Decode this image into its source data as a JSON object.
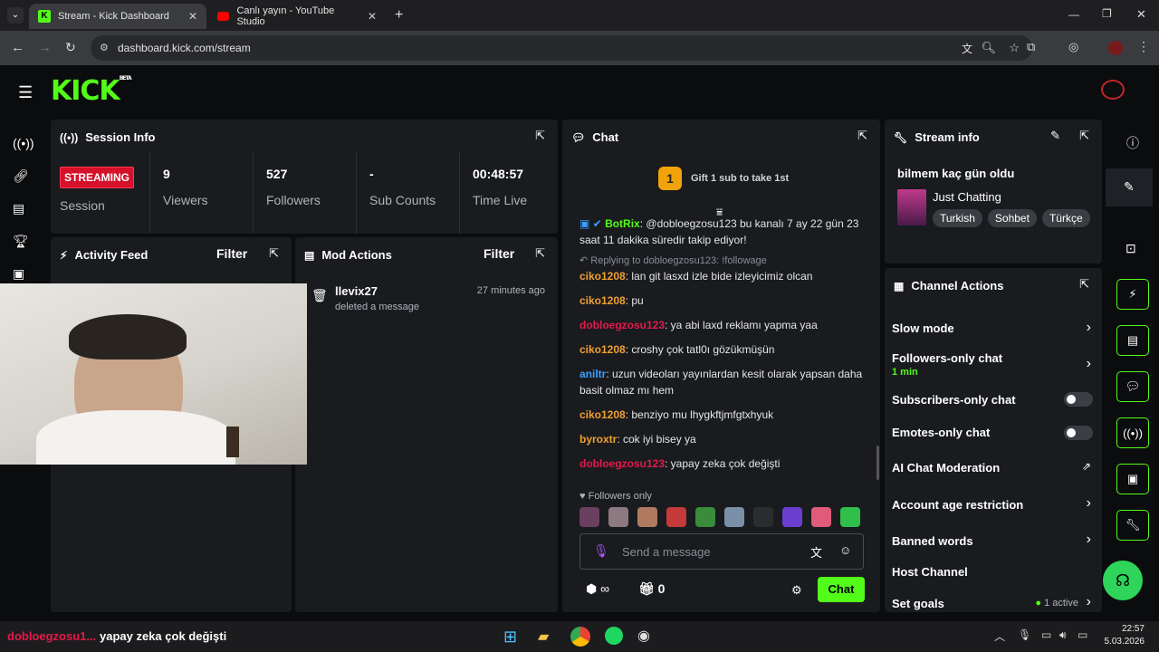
{
  "browser": {
    "tabs": [
      {
        "label": "Stream - Kick Dashboard"
      },
      {
        "label": "Canlı yayın - YouTube Studio"
      }
    ],
    "url": "dashboard.kick.com/stream"
  },
  "brand": {
    "logo": "KICK",
    "badge": "BETA",
    "accent": "#53fc18"
  },
  "session": {
    "title": "Session Info",
    "status": "STREAMING",
    "status_label": "Session",
    "stats": [
      {
        "value": "9",
        "label": "Viewers"
      },
      {
        "value": "527",
        "label": "Followers"
      },
      {
        "value": "-",
        "label": "Sub Counts"
      },
      {
        "value": "00:48:57",
        "label": "Time Live"
      }
    ]
  },
  "activity": {
    "title": "Activity Feed",
    "filter": "Filter"
  },
  "mod": {
    "title": "Mod Actions",
    "filter": "Filter",
    "items": [
      {
        "user": "llevix27",
        "action": "deleted a message",
        "time": "27 minutes ago"
      }
    ]
  },
  "chat": {
    "title": "Chat",
    "gift": "Gift 1 sub to take 1st",
    "gift_count": "1",
    "bot_user": "BotRix",
    "bot_msg": ": @dobloegzosu123 bu kanalı 7 ay 22 gün 23 saat 11 dakika süredir takip ediyor!",
    "reply_label": "Replying to dobloegzosu123: !followage",
    "messages": [
      {
        "user": "ciko1208",
        "color": "#f0a030",
        "text": ": lan git lasxd izle bide izleyicimiz olcan"
      },
      {
        "user": "ciko1208",
        "color": "#f0a030",
        "text": ": pu"
      },
      {
        "user": "dobloegzosu123",
        "color": "#e5194a",
        "text": ": ya abi laxd reklamı yapma yaa"
      },
      {
        "user": "ciko1208",
        "color": "#f0a030",
        "text": ": croshy çok tatl0ı gözükmüşün"
      },
      {
        "user": "aniltr",
        "color": "#3aa0ff",
        "text": ": uzun videoları yayınlardan kesit olarak yapsan daha basit olmaz mı hem"
      },
      {
        "user": "ciko1208",
        "color": "#f0a030",
        "text": ": benziyo mu lhygkftjmfgtxhyuk"
      },
      {
        "user": "byroxtr",
        "color": "#f0a030",
        "text": ": cok iyi bisey ya"
      },
      {
        "user": "dobloegzosu123",
        "color": "#e5194a",
        "text": ": yapay zeka çok değişti"
      }
    ],
    "followers_only": "Followers only",
    "placeholder": "Send a message",
    "points": "∞",
    "gift_points": "0",
    "send": "Chat"
  },
  "stream_info": {
    "title": "Stream info",
    "stream_title": "bilmem kaç gün oldu",
    "category": "Just Chatting",
    "tags": [
      "Turkish",
      "Sohbet",
      "Türkçe"
    ]
  },
  "channel": {
    "title": "Channel Actions",
    "actions": [
      {
        "label": "Slow mode",
        "kind": "chevron"
      },
      {
        "label": "Followers-only chat",
        "sub": "1 min",
        "kind": "chevron"
      },
      {
        "label": "Subscribers-only chat",
        "kind": "toggle"
      },
      {
        "label": "Emotes-only chat",
        "kind": "toggle"
      },
      {
        "label": "AI Chat Moderation",
        "kind": "external"
      },
      {
        "label": "Account age restriction",
        "kind": "chevron"
      },
      {
        "label": "Banned words",
        "kind": "chevron"
      },
      {
        "label": "Host Channel",
        "kind": "none"
      },
      {
        "label": "Set goals",
        "kind": "chevron",
        "status": "1 active"
      }
    ]
  },
  "overlay": {
    "user": "dobloegzosu1...",
    "msg": "yapay zeka çok değişti"
  },
  "clock": {
    "time": "22:57",
    "date": "5.03.2026"
  }
}
